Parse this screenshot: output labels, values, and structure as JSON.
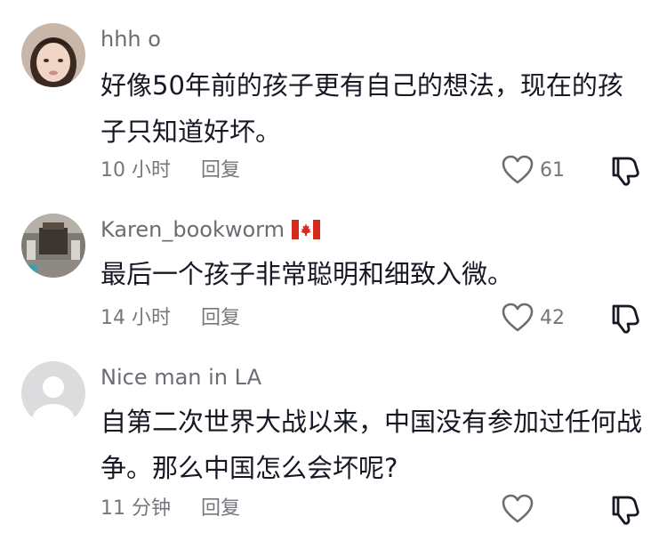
{
  "comments": [
    {
      "username": "hhh o",
      "text": "好像50年前的孩子更有自己的想法，现在的孩子只知道好坏。",
      "time": "10 小时",
      "reply_label": "回复",
      "like_count": "61",
      "avatar": "avatar-photo-girl"
    },
    {
      "username": "Karen_bookworm",
      "flag": "canada-flag-icon",
      "text": "最后一个孩子非常聪明和细致入微。",
      "time": "14 小时",
      "reply_label": "回复",
      "like_count": "42",
      "avatar": "avatar-photo-temple"
    },
    {
      "username": "Nice man in LA",
      "text": "自第二次世界大战以来，中国没有参加过任何战争。那么中国怎么会坏呢?",
      "time": "11 分钟",
      "reply_label": "回复",
      "like_count": "",
      "avatar": "avatar-default"
    }
  ],
  "colors": {
    "username": "#6b6d74",
    "meta": "#75777d",
    "text": "#161823",
    "flag_red": "#d52b1e"
  }
}
